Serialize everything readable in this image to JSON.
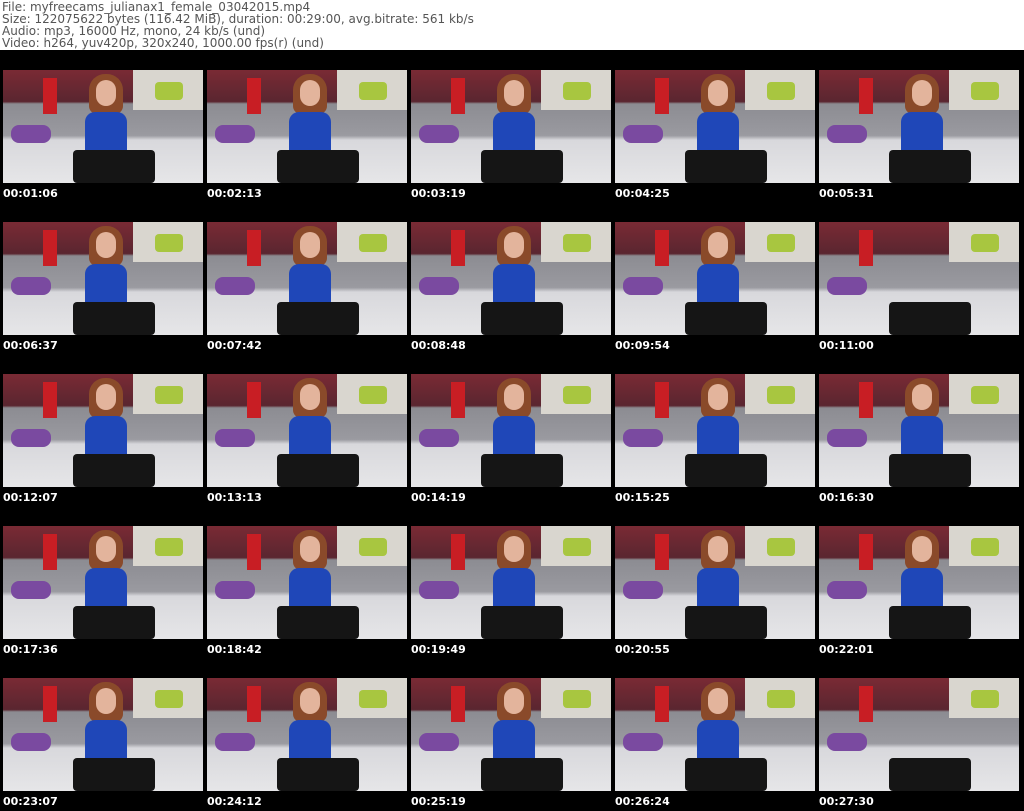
{
  "header": {
    "file": "File: myfreecams_julianax1_female_03042015.mp4",
    "size": "Size: 122075622 bytes (116.42 MiB), duration: 00:29:00, avg.bitrate: 561 kb/s",
    "audio": "Audio: mp3, 16000 Hz, mono, 24 kb/s (und)",
    "video": "Video: h264, yuv420p, 320x240, 1000.00 fps(r) (und)"
  },
  "thumbnails": [
    "00:01:06",
    "00:02:13",
    "00:03:19",
    "00:04:25",
    "00:05:31",
    "00:06:37",
    "00:07:42",
    "00:08:48",
    "00:09:54",
    "00:11:00",
    "00:12:07",
    "00:13:13",
    "00:14:19",
    "00:15:25",
    "00:16:30",
    "00:17:36",
    "00:18:42",
    "00:19:49",
    "00:20:55",
    "00:22:01",
    "00:23:07",
    "00:24:12",
    "00:25:19",
    "00:26:24",
    "00:27:30"
  ]
}
